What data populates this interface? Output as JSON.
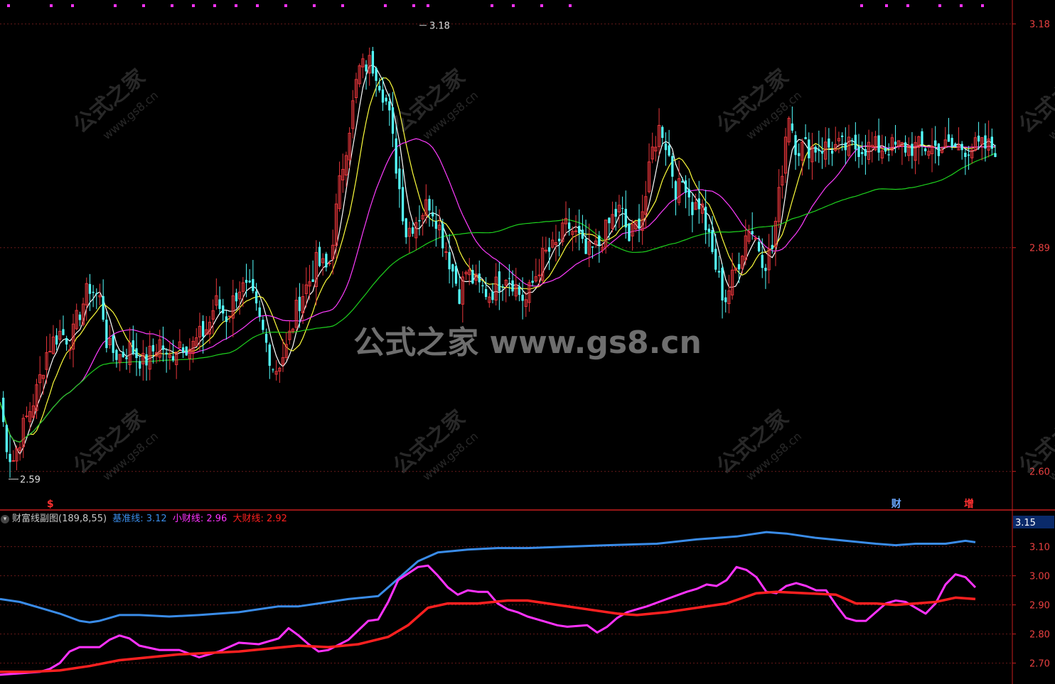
{
  "colors": {
    "up": "#e8363b",
    "down": "#54ffff",
    "ma5": "#ffffff",
    "ma10": "#ffff3c",
    "ma20": "#ff3cff",
    "ma60": "#1ed21e",
    "base_line": "#3a8ce8",
    "small_wealth": "#ff32ff",
    "big_wealth": "#ff2020",
    "axis": "#c81e1e"
  },
  "main_chart": {
    "y_ticks": [
      "3.18",
      "2.89",
      "2.60"
    ],
    "high_label": "3.18",
    "low_label": "2.59",
    "markers": [
      {
        "text": "$",
        "color": "#ff3030",
        "pos": 0.047
      },
      {
        "text": "财",
        "color": "#6aa8ff",
        "pos": 0.897
      },
      {
        "text": "增",
        "color": "#ff3030",
        "pos": 0.97
      }
    ]
  },
  "indicator": {
    "collapse_icon": "chevron-down-icon",
    "name": "财富线副图",
    "params": "(189,8,55)",
    "base_label": "基准线:",
    "base_value": "3.12",
    "small_label": "小财线:",
    "small_value": "2.96",
    "big_label": "大财线:",
    "big_value": "2.92",
    "y_ticks": [
      "3.10",
      "3.00",
      "2.90",
      "2.80",
      "2.70"
    ],
    "current_label": "3.15"
  },
  "watermark": {
    "center": "公式之家 www.gs8.cn",
    "small_cn": "公式之家",
    "small_url": "www.gs8.cn"
  },
  "chart_data": [
    {
      "type": "candlestick",
      "ylim": [
        2.585,
        3.2
      ],
      "y_ticks": [
        3.18,
        2.89,
        2.6
      ],
      "annotations": [
        {
          "text": "3.18",
          "kind": "high"
        },
        {
          "text": "2.59",
          "kind": "low"
        }
      ],
      "close_path": [
        [
          0,
          2.69
        ],
        [
          0.01,
          2.64
        ],
        [
          0.02,
          2.61
        ],
        [
          0.04,
          2.66
        ],
        [
          0.06,
          2.7
        ],
        [
          0.08,
          2.76
        ],
        [
          0.1,
          2.78
        ],
        [
          0.12,
          2.77
        ],
        [
          0.13,
          2.8
        ],
        [
          0.15,
          2.84
        ],
        [
          0.17,
          2.82
        ],
        [
          0.18,
          2.76
        ],
        [
          0.2,
          2.75
        ],
        [
          0.22,
          2.76
        ],
        [
          0.24,
          2.74
        ],
        [
          0.25,
          2.75
        ],
        [
          0.27,
          2.77
        ],
        [
          0.28,
          2.74
        ],
        [
          0.3,
          2.77
        ],
        [
          0.32,
          2.76
        ],
        [
          0.33,
          2.77
        ],
        [
          0.35,
          2.79
        ],
        [
          0.36,
          2.82
        ],
        [
          0.38,
          2.8
        ],
        [
          0.4,
          2.84
        ],
        [
          0.42,
          2.83
        ],
        [
          0.44,
          2.78
        ],
        [
          0.46,
          2.73
        ],
        [
          0.48,
          2.76
        ],
        [
          0.5,
          2.82
        ],
        [
          0.52,
          2.85
        ],
        [
          0.53,
          2.87
        ],
        [
          0.55,
          2.86
        ],
        [
          0.57,
          2.98
        ],
        [
          0.59,
          3.07
        ],
        [
          0.6,
          3.12
        ],
        [
          0.62,
          3.13
        ],
        [
          0.63,
          3.12
        ],
        [
          0.65,
          3.07
        ],
        [
          0.67,
          2.96
        ],
        [
          0.68,
          2.91
        ],
        [
          0.7,
          2.93
        ],
        [
          0.72,
          2.95
        ],
        [
          0.73,
          2.93
        ],
        [
          0.75,
          2.88
        ],
        [
          0.77,
          2.83
        ],
        [
          0.78,
          2.86
        ],
        [
          0.8,
          2.84
        ],
        [
          0.82,
          2.83
        ],
        [
          0.83,
          2.84
        ],
        [
          0.85,
          2.86
        ],
        [
          0.87,
          2.83
        ],
        [
          0.88,
          2.82
        ],
        [
          0.9,
          2.86
        ],
        [
          0.91,
          2.88
        ],
        [
          0.93,
          2.89
        ],
        [
          0.95,
          2.92
        ],
        [
          0.97,
          2.9
        ],
        [
          0.98,
          2.88
        ],
        [
          1.0,
          2.89
        ]
      ],
      "close_path_note": "cont",
      "close_path2": [
        [
          0,
          2.89
        ],
        [
          0.02,
          2.91
        ],
        [
          0.04,
          2.93
        ],
        [
          0.06,
          2.94
        ],
        [
          0.08,
          2.9
        ],
        [
          0.1,
          2.92
        ],
        [
          0.12,
          2.95
        ],
        [
          0.14,
          3.02
        ],
        [
          0.16,
          3.05
        ],
        [
          0.18,
          3.01
        ],
        [
          0.2,
          2.96
        ],
        [
          0.22,
          2.98
        ],
        [
          0.24,
          2.94
        ],
        [
          0.26,
          2.95
        ],
        [
          0.28,
          2.9
        ],
        [
          0.3,
          2.86
        ],
        [
          0.32,
          2.82
        ],
        [
          0.34,
          2.85
        ],
        [
          0.36,
          2.88
        ],
        [
          0.38,
          2.92
        ],
        [
          0.4,
          2.9
        ],
        [
          0.42,
          2.87
        ],
        [
          0.44,
          2.89
        ],
        [
          0.46,
          2.97
        ],
        [
          0.48,
          3.07
        ],
        [
          0.5,
          3.02
        ]
      ]
    },
    {
      "type": "line",
      "ylim": [
        2.66,
        3.16
      ],
      "y_ticks": [
        3.1,
        3.0,
        2.9,
        2.8,
        2.7
      ],
      "series": [
        {
          "name": "基准线",
          "color": "#3a8ce8",
          "points": [
            [
              0,
              2.92
            ],
            [
              0.02,
              2.91
            ],
            [
              0.04,
              2.89
            ],
            [
              0.06,
              2.87
            ],
            [
              0.08,
              2.845
            ],
            [
              0.09,
              2.84
            ],
            [
              0.1,
              2.845
            ],
            [
              0.11,
              2.855
            ],
            [
              0.12,
              2.865
            ],
            [
              0.14,
              2.865
            ],
            [
              0.17,
              2.86
            ],
            [
              0.2,
              2.865
            ],
            [
              0.24,
              2.875
            ],
            [
              0.28,
              2.895
            ],
            [
              0.3,
              2.895
            ],
            [
              0.32,
              2.905
            ],
            [
              0.35,
              2.92
            ],
            [
              0.38,
              2.93
            ],
            [
              0.4,
              2.99
            ],
            [
              0.42,
              3.05
            ],
            [
              0.44,
              3.08
            ],
            [
              0.47,
              3.09
            ],
            [
              0.5,
              3.095
            ],
            [
              0.53,
              3.095
            ],
            [
              0.57,
              3.1
            ],
            [
              0.61,
              3.105
            ],
            [
              0.66,
              3.11
            ],
            [
              0.7,
              3.125
            ],
            [
              0.74,
              3.135
            ],
            [
              0.77,
              3.15
            ],
            [
              0.79,
              3.145
            ],
            [
              0.82,
              3.13
            ],
            [
              0.85,
              3.12
            ],
            [
              0.88,
              3.11
            ],
            [
              0.9,
              3.105
            ],
            [
              0.92,
              3.11
            ],
            [
              0.95,
              3.11
            ],
            [
              0.97,
              3.12
            ],
            [
              0.98,
              3.115
            ]
          ]
        },
        {
          "name": "小财线",
          "color": "#ff32ff",
          "points": [
            [
              0,
              2.66
            ],
            [
              0.02,
              2.665
            ],
            [
              0.04,
              2.67
            ],
            [
              0.05,
              2.68
            ],
            [
              0.06,
              2.7
            ],
            [
              0.07,
              2.74
            ],
            [
              0.08,
              2.755
            ],
            [
              0.1,
              2.755
            ],
            [
              0.11,
              2.78
            ],
            [
              0.12,
              2.795
            ],
            [
              0.13,
              2.785
            ],
            [
              0.14,
              2.76
            ],
            [
              0.16,
              2.745
            ],
            [
              0.18,
              2.745
            ],
            [
              0.2,
              2.72
            ],
            [
              0.22,
              2.74
            ],
            [
              0.24,
              2.77
            ],
            [
              0.26,
              2.765
            ],
            [
              0.28,
              2.785
            ],
            [
              0.29,
              2.82
            ],
            [
              0.3,
              2.795
            ],
            [
              0.31,
              2.765
            ],
            [
              0.32,
              2.74
            ],
            [
              0.33,
              2.745
            ],
            [
              0.35,
              2.78
            ],
            [
              0.37,
              2.845
            ],
            [
              0.38,
              2.85
            ],
            [
              0.39,
              2.91
            ],
            [
              0.4,
              2.985
            ],
            [
              0.42,
              3.03
            ],
            [
              0.43,
              3.035
            ],
            [
              0.44,
              3.0
            ],
            [
              0.45,
              2.96
            ],
            [
              0.46,
              2.935
            ],
            [
              0.47,
              2.95
            ],
            [
              0.48,
              2.945
            ],
            [
              0.49,
              2.945
            ],
            [
              0.5,
              2.905
            ],
            [
              0.51,
              2.885
            ],
            [
              0.52,
              2.875
            ],
            [
              0.53,
              2.86
            ],
            [
              0.54,
              2.85
            ],
            [
              0.56,
              2.83
            ],
            [
              0.57,
              2.825
            ],
            [
              0.59,
              2.83
            ],
            [
              0.6,
              2.805
            ],
            [
              0.61,
              2.825
            ],
            [
              0.62,
              2.855
            ],
            [
              0.63,
              2.875
            ],
            [
              0.65,
              2.895
            ],
            [
              0.67,
              2.92
            ],
            [
              0.69,
              2.945
            ],
            [
              0.7,
              2.955
            ],
            [
              0.71,
              2.97
            ],
            [
              0.72,
              2.965
            ],
            [
              0.73,
              2.985
            ],
            [
              0.74,
              3.03
            ],
            [
              0.75,
              3.02
            ],
            [
              0.76,
              2.995
            ],
            [
              0.77,
              2.945
            ],
            [
              0.78,
              2.94
            ],
            [
              0.79,
              2.965
            ],
            [
              0.8,
              2.975
            ],
            [
              0.81,
              2.965
            ],
            [
              0.82,
              2.95
            ],
            [
              0.83,
              2.95
            ],
            [
              0.84,
              2.9
            ],
            [
              0.85,
              2.855
            ],
            [
              0.86,
              2.845
            ],
            [
              0.87,
              2.845
            ],
            [
              0.88,
              2.875
            ],
            [
              0.89,
              2.905
            ],
            [
              0.9,
              2.915
            ],
            [
              0.91,
              2.91
            ],
            [
              0.92,
              2.89
            ],
            [
              0.93,
              2.87
            ],
            [
              0.94,
              2.905
            ],
            [
              0.95,
              2.97
            ],
            [
              0.96,
              3.005
            ],
            [
              0.97,
              2.995
            ],
            [
              0.98,
              2.96
            ]
          ]
        },
        {
          "name": "大财线",
          "color": "#ff2020",
          "points": [
            [
              0,
              2.67
            ],
            [
              0.03,
              2.67
            ],
            [
              0.06,
              2.675
            ],
            [
              0.09,
              2.69
            ],
            [
              0.12,
              2.71
            ],
            [
              0.15,
              2.72
            ],
            [
              0.18,
              2.73
            ],
            [
              0.21,
              2.735
            ],
            [
              0.24,
              2.74
            ],
            [
              0.27,
              2.75
            ],
            [
              0.3,
              2.76
            ],
            [
              0.33,
              2.755
            ],
            [
              0.36,
              2.765
            ],
            [
              0.39,
              2.79
            ],
            [
              0.41,
              2.83
            ],
            [
              0.43,
              2.89
            ],
            [
              0.45,
              2.905
            ],
            [
              0.48,
              2.905
            ],
            [
              0.51,
              2.915
            ],
            [
              0.53,
              2.915
            ],
            [
              0.56,
              2.9
            ],
            [
              0.59,
              2.885
            ],
            [
              0.62,
              2.87
            ],
            [
              0.64,
              2.865
            ],
            [
              0.67,
              2.875
            ],
            [
              0.7,
              2.89
            ],
            [
              0.73,
              2.905
            ],
            [
              0.76,
              2.94
            ],
            [
              0.78,
              2.945
            ],
            [
              0.81,
              2.94
            ],
            [
              0.84,
              2.935
            ],
            [
              0.86,
              2.905
            ],
            [
              0.88,
              2.905
            ],
            [
              0.9,
              2.9
            ],
            [
              0.92,
              2.905
            ],
            [
              0.94,
              2.91
            ],
            [
              0.96,
              2.925
            ],
            [
              0.98,
              2.92
            ]
          ]
        }
      ]
    }
  ]
}
